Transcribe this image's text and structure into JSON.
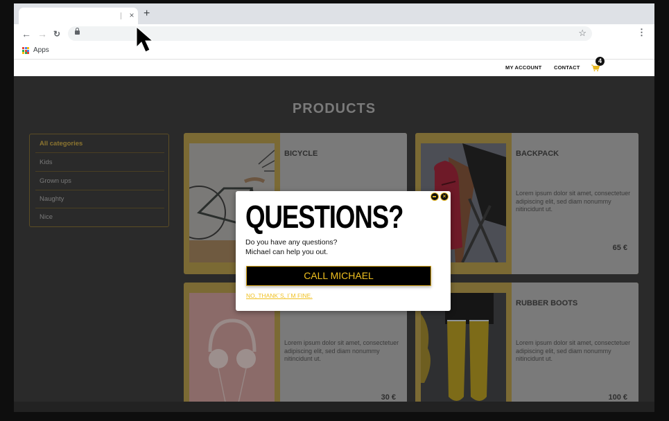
{
  "browser": {
    "tab": {
      "title": "",
      "close_icon": "×"
    },
    "new_tab_icon": "+",
    "nav": {
      "back_icon": "←",
      "forward_icon": "→",
      "reload_icon": "C"
    },
    "address": {
      "value": "",
      "lock_icon": "lock"
    },
    "star_icon": "☆",
    "menu_icon": "⋮",
    "bookmarks": {
      "apps_label": "Apps"
    }
  },
  "site_header": {
    "links": [
      "MY ACCOUNT",
      "CONTACT"
    ],
    "cart_count": "4",
    "accent_color": "#e8b820"
  },
  "page": {
    "title": "PRODUCTS",
    "categories": [
      {
        "label": "All categories",
        "active": true
      },
      {
        "label": "Kids",
        "active": false
      },
      {
        "label": "Grown ups",
        "active": false
      },
      {
        "label": "Naughty",
        "active": false
      },
      {
        "label": "Nice",
        "active": false
      }
    ],
    "products": [
      {
        "name": "BICYCLE",
        "description": "",
        "price": ""
      },
      {
        "name": "BACKPACK",
        "description": "Lorem ipsum dolor sit amet, consectetuer adipiscing elit, sed diam nonummy nitincidunt ut.",
        "price": "65 €"
      },
      {
        "name": "",
        "description": "Lorem ipsum dolor sit amet, consectetuer adipiscing elit, sed diam nonummy nitincidunt ut.",
        "price": "30 €"
      },
      {
        "name": "RUBBER BOOTS",
        "description": "Lorem ipsum dolor sit amet, consectetuer adipiscing elit, sed diam nonummy nitincidunt ut.",
        "price": "100 €"
      }
    ]
  },
  "modal": {
    "title": "QUESTIONS?",
    "text_line1": "Do you have any questions?",
    "text_line2": "Michael can help you out.",
    "cta_label": "CALL MICHAEL",
    "decline_label": "NO, THANK´S, I´M FINE.",
    "minimize_icon": "minimize",
    "close_icon": "×",
    "cta_text_color": "#f0c020"
  }
}
